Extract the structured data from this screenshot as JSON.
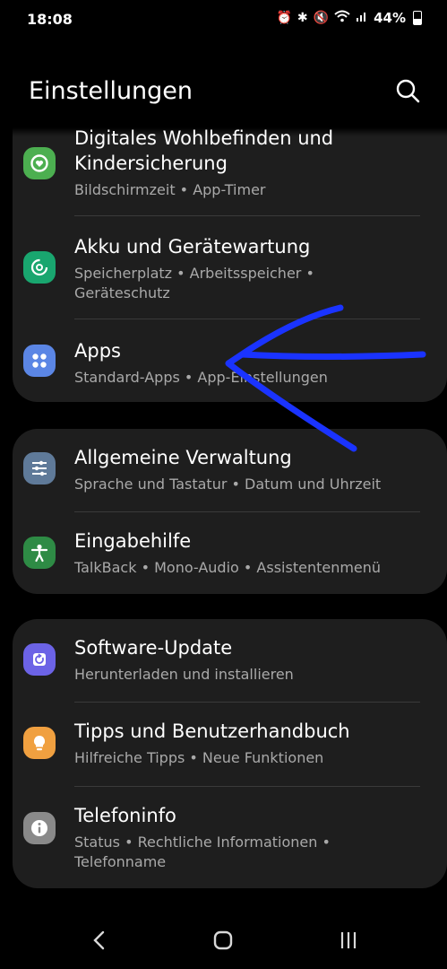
{
  "status": {
    "time": "18:08",
    "battery": "44%"
  },
  "header": {
    "title": "Einstellungen"
  },
  "groups": [
    {
      "items": [
        {
          "title_line1": "Digitales Wohlbefinden und",
          "title_line2": "Kindersicherung",
          "sub": "Bildschirmzeit  •  App-Timer",
          "icon_color": "#4caf50"
        },
        {
          "title": "Akku und Gerätewartung",
          "sub_line1": "Speicherplatz  •  Arbeitsspeicher  •",
          "sub_line2": "Geräteschutz",
          "icon_color": "#19a66f"
        },
        {
          "title": "Apps",
          "sub": "Standard-Apps  •  App-Einstellungen",
          "icon_color": "#5b86e5"
        }
      ]
    },
    {
      "items": [
        {
          "title": "Allgemeine Verwaltung",
          "sub": "Sprache und Tastatur  •  Datum und Uhrzeit",
          "icon_color": "#5f7a99"
        },
        {
          "title": "Eingabehilfe",
          "sub": "TalkBack  •  Mono-Audio  •  Assistentenmenü",
          "icon_color": "#2e8b45"
        }
      ]
    },
    {
      "items": [
        {
          "title": "Software-Update",
          "sub": "Herunterladen und installieren",
          "icon_color": "#6c63e6"
        },
        {
          "title": "Tipps und Benutzerhandbuch",
          "sub": "Hilfreiche Tipps  •  Neue Funktionen",
          "icon_color": "#f0a040"
        },
        {
          "title": "Telefoninfo",
          "sub_line1": "Status  •  Rechtliche Informationen  •",
          "sub_line2": "Telefonname",
          "icon_color": "#8a8a8a"
        }
      ]
    }
  ],
  "annotation_color": "#1a33ff",
  "icons": {
    "search": "search-icon",
    "wellbeing": "heart-ring-icon",
    "device_care": "refresh-circle-icon",
    "apps": "four-dots-icon",
    "general": "sliders-icon",
    "accessibility": "person-icon",
    "update": "update-icon",
    "tips": "lightbulb-icon",
    "info": "info-icon",
    "back": "back-icon",
    "home": "home-icon",
    "recents": "recents-icon"
  }
}
